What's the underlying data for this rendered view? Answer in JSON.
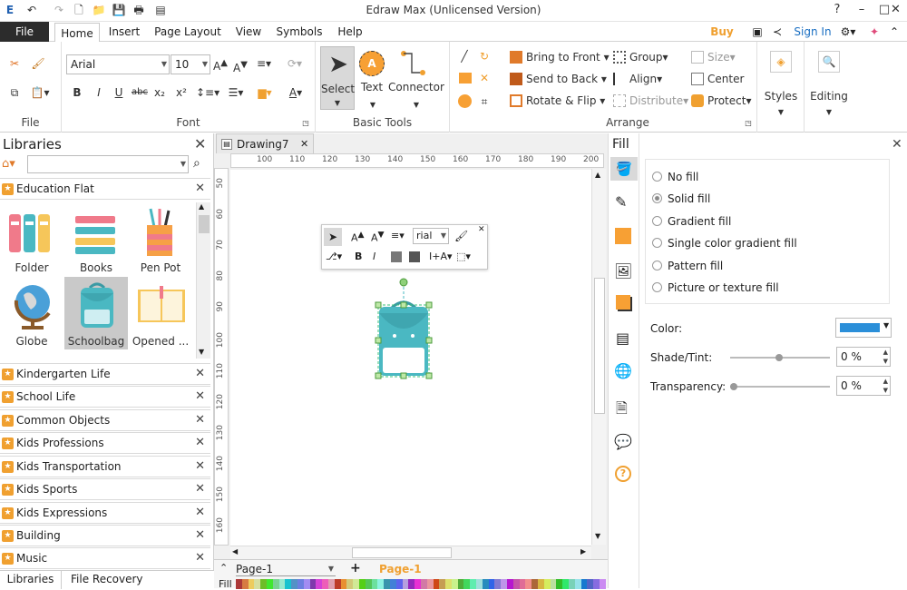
{
  "window": {
    "title": "Edraw Max (Unlicensed Version)"
  },
  "tabs": [
    {
      "label": "File"
    },
    {
      "label": "Home"
    },
    {
      "label": "Insert"
    },
    {
      "label": "Page Layout"
    },
    {
      "label": "View"
    },
    {
      "label": "Symbols"
    },
    {
      "label": "Help"
    }
  ],
  "header_right": {
    "buy_now": "Buy Now",
    "sign_in": "Sign In"
  },
  "ribbon": {
    "file_group": "File",
    "font_group": "Font",
    "font_name": "Arial",
    "font_size": "10",
    "basic_tools_group": "Basic Tools",
    "select_label": "Select",
    "text_label": "Text",
    "connector_label": "Connector",
    "arrange_group": "Arrange",
    "bring_to_front": "Bring to Front",
    "send_to_back": "Send to Back",
    "rotate_flip": "Rotate & Flip",
    "group": "Group",
    "align": "Align",
    "distribute": "Distribute",
    "size": "Size",
    "center": "Center",
    "protect": "Protect",
    "styles": "Styles",
    "editing": "Editing"
  },
  "libraries": {
    "title": "Libraries",
    "search_placeholder": "",
    "active_library": "Education Flat",
    "shapes": [
      {
        "label": "Folder"
      },
      {
        "label": "Books"
      },
      {
        "label": "Pen Pot"
      },
      {
        "label": "Globe"
      },
      {
        "label": "Schoolbag"
      },
      {
        "label": "Opened ..."
      }
    ],
    "list": [
      {
        "label": "Kindergarten Life"
      },
      {
        "label": "School Life"
      },
      {
        "label": "Common Objects"
      },
      {
        "label": "Kids Professions"
      },
      {
        "label": "Kids Transportation"
      },
      {
        "label": "Kids Sports"
      },
      {
        "label": "Kids Expressions"
      },
      {
        "label": "Building"
      },
      {
        "label": "Music"
      }
    ],
    "bottom_tabs": [
      {
        "label": "Libraries"
      },
      {
        "label": "File Recovery"
      }
    ]
  },
  "document": {
    "tab_name": "Drawing7",
    "ruler_h": [
      "100",
      "110",
      "120",
      "130",
      "140",
      "150",
      "160",
      "170",
      "180",
      "190",
      "200"
    ],
    "ruler_v": [
      "50",
      "60",
      "70",
      "80",
      "90",
      "100",
      "110",
      "120",
      "130",
      "140",
      "150",
      "160"
    ],
    "mini_font": "rial",
    "page_selector": "Page-1",
    "page_tab": "Page-1",
    "fill_label": "Fill"
  },
  "fill_panel": {
    "title": "Fill",
    "options": [
      {
        "label": "No fill"
      },
      {
        "label": "Solid fill"
      },
      {
        "label": "Gradient fill"
      },
      {
        "label": "Single color gradient fill"
      },
      {
        "label": "Pattern fill"
      },
      {
        "label": "Picture or texture fill"
      }
    ],
    "selected_option": "Solid fill",
    "color_label": "Color:",
    "color_value": "#2b8fd9",
    "shade_label": "Shade/Tint:",
    "shade_value": "0 %",
    "transparency_label": "Transparency:",
    "transparency_value": "0 %"
  },
  "colors": {
    "accent": "#f0a030",
    "sign_in": "#1a6fc2",
    "shape_teal": "#4ab8c2"
  }
}
